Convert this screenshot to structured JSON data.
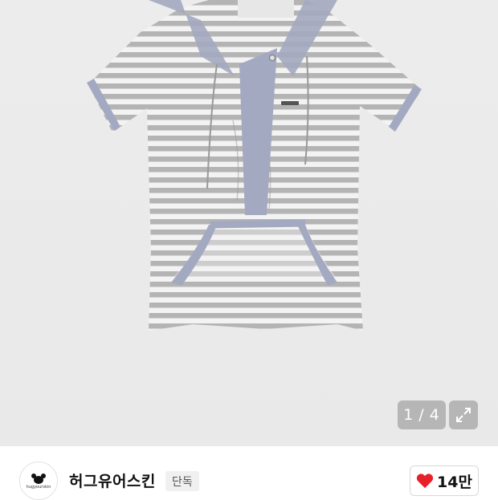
{
  "gallery": {
    "image_alt": "striped short sleeve hoodie",
    "current": "1",
    "separator": "/",
    "total": "4",
    "expand_icon": "expand-icon"
  },
  "shop": {
    "logo_text": "hugyourskin",
    "name": "허그유어스킨",
    "badge": "단독",
    "likes": "14만",
    "heart_color": "#e8202a",
    "heart_icon": "heart-icon"
  },
  "colors": {
    "stripe_gray": "#b2b2b2",
    "stripe_light": "#f3f3f3",
    "trim_blue": "#a3a9c0"
  }
}
